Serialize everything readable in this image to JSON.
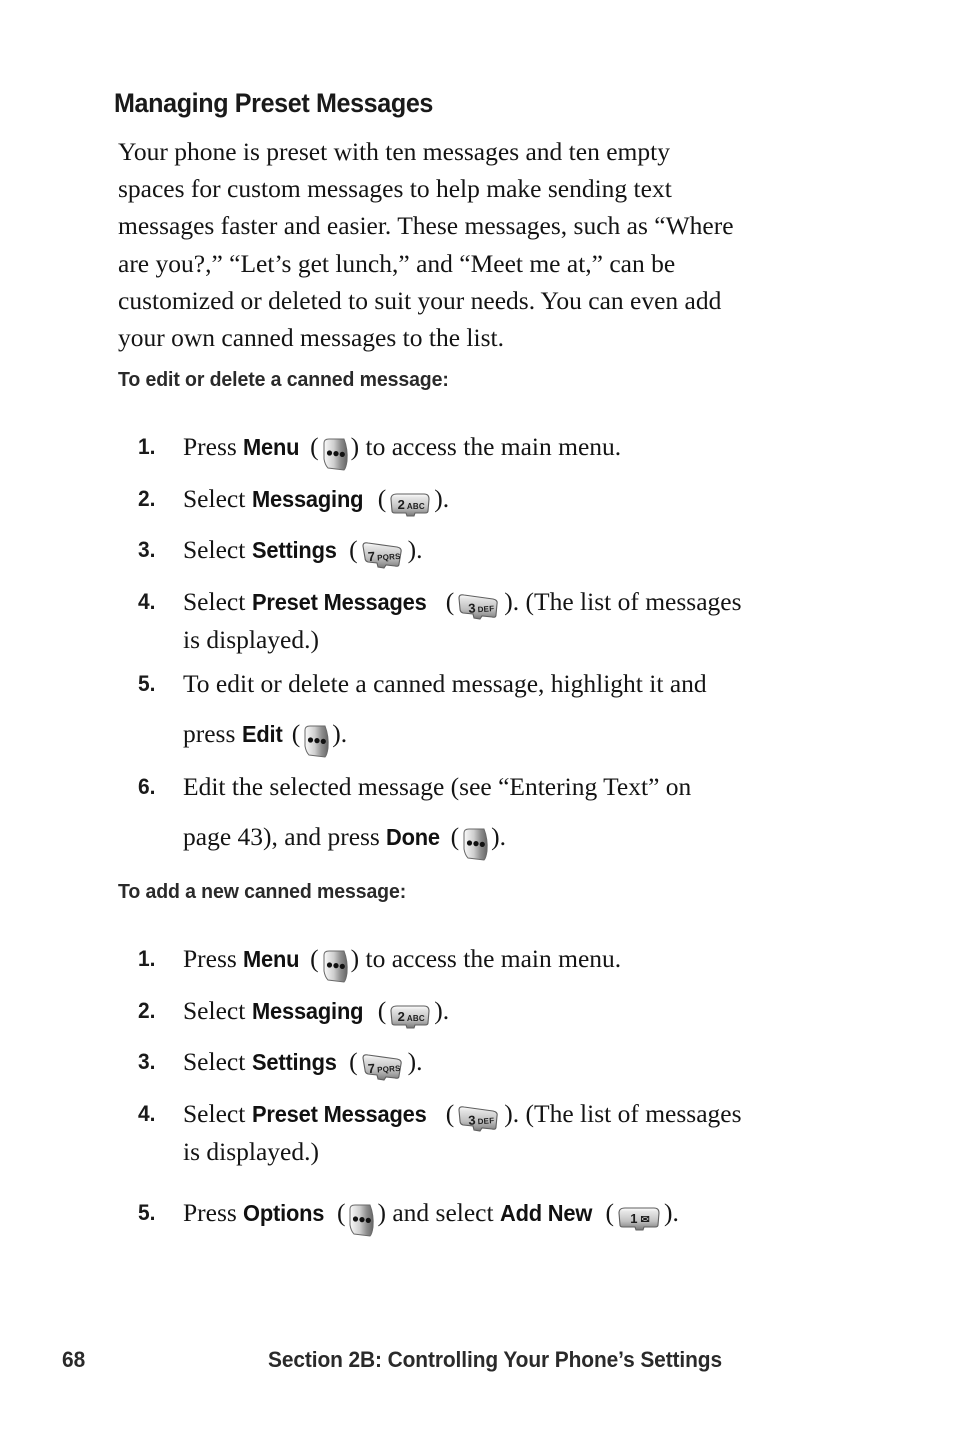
{
  "heading": "Managing Preset Messages",
  "intro_lines": [
    "Your phone is preset with ten messages and ten empty",
    "spaces for custom messages to help make sending text",
    "messages faster and easier. These messages, such as “Where",
    "are you?,” “Let’s get lunch,” and “Meet me at,” can be",
    "customized or deleted to suit your needs. You can even add",
    "your own canned messages to the list."
  ],
  "section1": {
    "subheading": "To edit or delete a canned message:",
    "steps": [
      {
        "num": "1.",
        "pre": "Press ",
        "cmd": "Menu",
        "key": "softkey",
        "post": " to access the main menu."
      },
      {
        "num": "2.",
        "pre": "Select ",
        "cmd": "Messaging",
        "key": "key-2",
        "post": "."
      },
      {
        "num": "3.",
        "pre": "Select ",
        "cmd": "Settings",
        "key": "key-7",
        "post": "."
      },
      {
        "num": "4.",
        "pre": "Select ",
        "cmd": "Preset Messages",
        "key": "key-3",
        "post": ". (The list of messages",
        "line2": "is displayed.)"
      },
      {
        "num": "5.",
        "line1": "To edit or delete a canned message, highlight it and",
        "pre": "press ",
        "cmd": "Edit",
        "key": "softkey",
        "post": "."
      },
      {
        "num": "6.",
        "line1": "Edit the selected message (see “Entering Text” on",
        "pre": "page 43), and press ",
        "cmd": "Done",
        "key": "softkey",
        "post": "."
      }
    ]
  },
  "section2": {
    "subheading": "To add a new canned message:",
    "steps": [
      {
        "num": "1.",
        "pre": "Press ",
        "cmd": "Menu",
        "key": "softkey",
        "post": " to access the main menu."
      },
      {
        "num": "2.",
        "pre": "Select ",
        "cmd": "Messaging",
        "key": "key-2",
        "post": "."
      },
      {
        "num": "3.",
        "pre": "Select ",
        "cmd": "Settings",
        "key": "key-7",
        "post": "."
      },
      {
        "num": "4.",
        "pre": "Select ",
        "cmd": "Preset Messages",
        "key": "key-3",
        "post": ". (The list of messages",
        "line2": "is displayed.)"
      },
      {
        "num": "5.",
        "pre": "Press ",
        "cmd": "Options",
        "key": "softkey",
        "mid": " and select ",
        "cmd2": "Add New",
        "key2": "key-1",
        "post": "."
      }
    ]
  },
  "keys": {
    "softkey": {
      "name": "menu-softkey",
      "dots": 3
    },
    "key-2": {
      "digit": "2",
      "letters": "ABC"
    },
    "key-3": {
      "digit": "3",
      "letters": "DEF"
    },
    "key-7": {
      "digit": "7",
      "letters": "PQRS"
    },
    "key-1": {
      "digit": "1",
      "letters": "✉"
    }
  },
  "footer": {
    "page_number": "68",
    "title": "Section 2B: Controlling Your Phone’s Settings"
  },
  "colors": {
    "text": "#141414",
    "heading": "#1a1a1a",
    "key_light": "#f2f2f2",
    "key_dark": "#6e6e6e",
    "background": "#ffffff"
  }
}
